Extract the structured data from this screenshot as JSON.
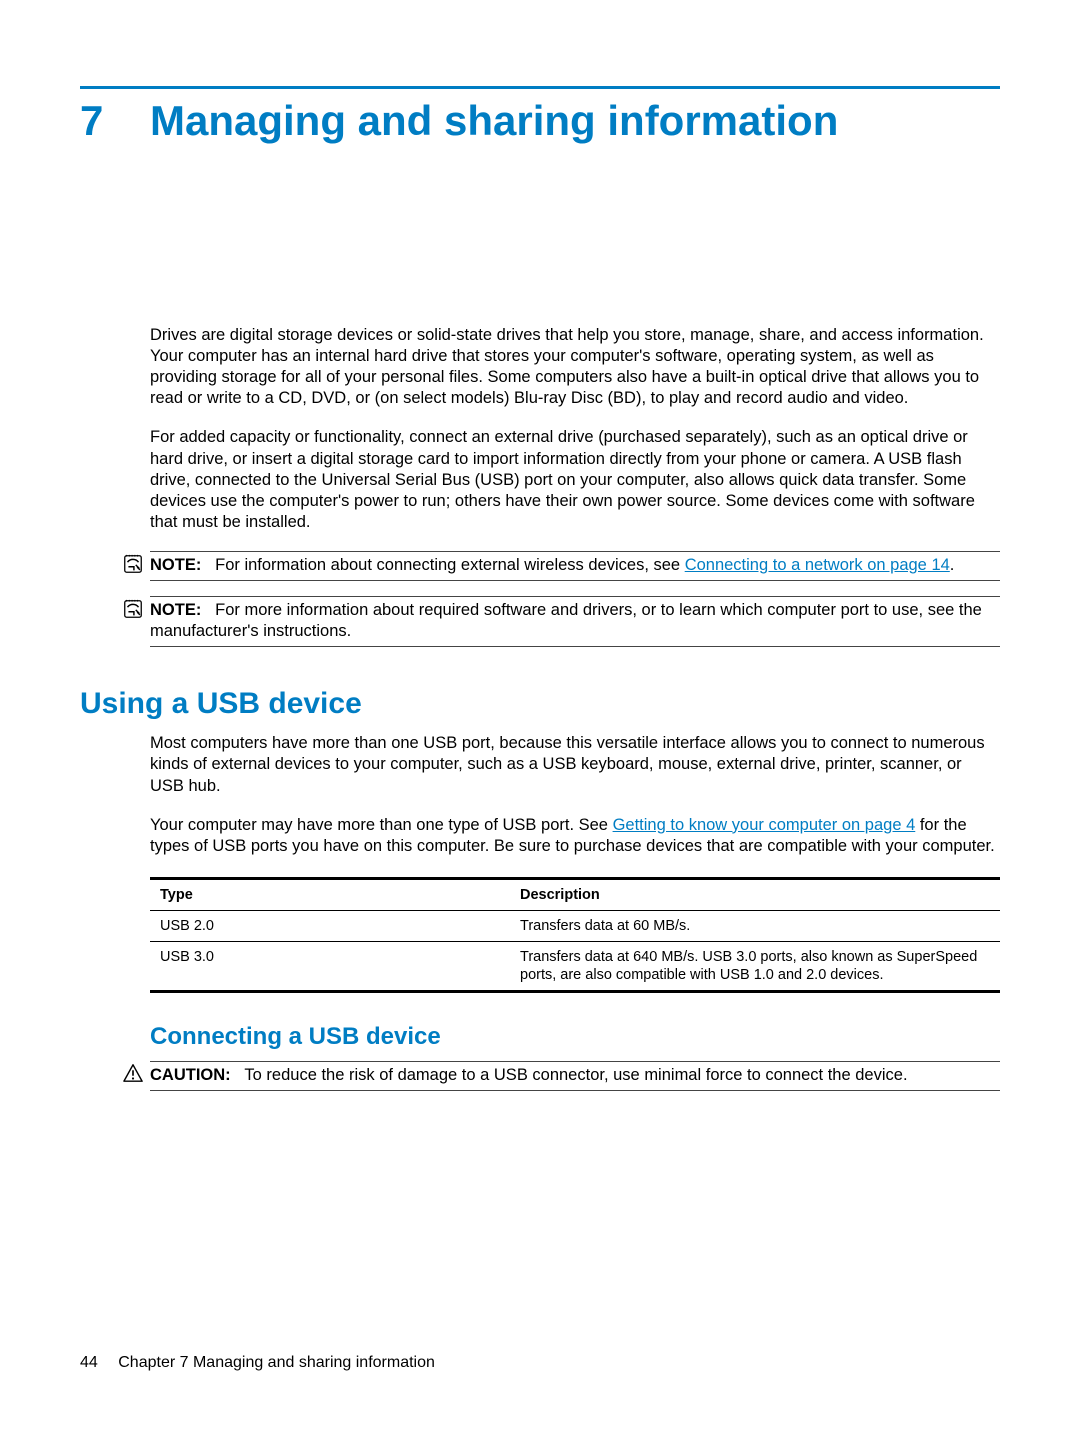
{
  "chapter": {
    "number": "7",
    "title": "Managing and sharing information"
  },
  "intro": {
    "p1": "Drives are digital storage devices or solid-state drives that help you store, manage, share, and access information. Your computer has an internal hard drive that stores your computer's software, operating system, as well as providing storage for all of your personal files. Some computers also have a built-in optical drive that allows you to read or write to a CD, DVD, or (on select models) Blu-ray Disc (BD), to play and record audio and video.",
    "p2": "For added capacity or functionality, connect an external drive (purchased separately), such as an optical drive or hard drive, or insert a digital storage card to import information directly from your phone or camera. A USB flash drive, connected to the Universal Serial Bus (USB) port on your computer, also allows quick data transfer. Some devices use the computer's power to run; others have their own power source. Some devices come with software that must be installed."
  },
  "note1": {
    "lead": "NOTE:",
    "pre": "For information about connecting external wireless devices, see ",
    "link": "Connecting to a network on page 14",
    "post": "."
  },
  "note2": {
    "lead": "NOTE:",
    "text": "For more information about required software and drivers, or to learn which computer port to use, see the manufacturer's instructions."
  },
  "usb": {
    "heading": "Using a USB device",
    "p1": "Most computers have more than one USB port, because this versatile interface allows you to connect to numerous kinds of external devices to your computer, such as a USB keyboard, mouse, external drive, printer, scanner, or USB hub.",
    "p2_pre": "Your computer may have more than one type of USB port. See ",
    "p2_link": "Getting to know your computer on page 4",
    "p2_post": " for the types of USB ports you have on this computer. Be sure to purchase devices that are compatible with your computer.",
    "table": {
      "head_type": "Type",
      "head_desc": "Description",
      "rows": [
        {
          "type": "USB 2.0",
          "desc": "Transfers data at 60 MB/s."
        },
        {
          "type": "USB 3.0",
          "desc": "Transfers data at 640 MB/s. USB 3.0 ports, also known as SuperSpeed ports, are also compatible with USB 1.0 and 2.0 devices."
        }
      ]
    }
  },
  "connect": {
    "heading": "Connecting a USB device",
    "caution_lead": "CAUTION:",
    "caution_text": "To reduce the risk of damage to a USB connector, use minimal force to connect the device."
  },
  "footer": {
    "page_num": "44",
    "chapter_label": "Chapter 7   Managing and sharing information"
  }
}
